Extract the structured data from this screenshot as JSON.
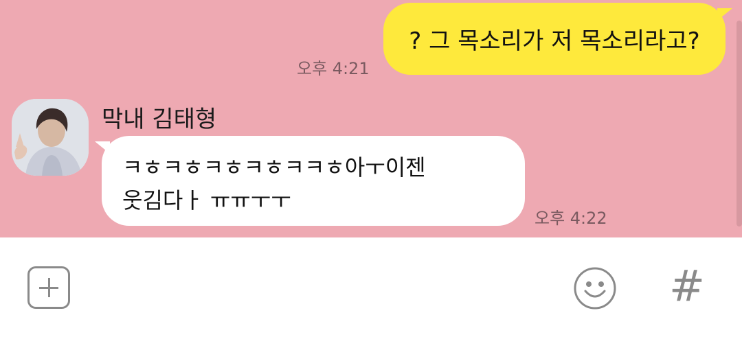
{
  "chat": {
    "messages": [
      {
        "direction": "outgoing",
        "text": "? 그 목소리가 저 목소리라고?",
        "time": "오후 4:21"
      },
      {
        "direction": "incoming",
        "sender": "막내 김태형",
        "text": "ㅋㅎㅋㅎㅋㅎㅋㅎㅋㅋㅎ아ㅜ이젠\n웃김다ㅏ ㅠㅠㅜㅜ",
        "time": "오후 4:22"
      }
    ],
    "colors": {
      "background": "#eea9b2",
      "outgoing_bubble": "#fee93c",
      "incoming_bubble": "#ffffff"
    }
  },
  "input_bar": {
    "icons": [
      "plus-icon",
      "emoji-icon",
      "hash-icon"
    ]
  }
}
